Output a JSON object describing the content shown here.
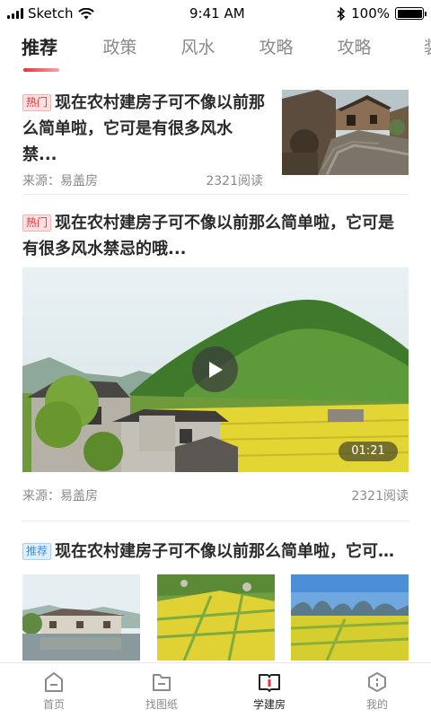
{
  "status_bar": {
    "carrier": "Sketch",
    "time": "9:41 AM",
    "battery": "100%",
    "battery_level": 1.0
  },
  "tabs": [
    {
      "label": "推荐",
      "active": true
    },
    {
      "label": "政策"
    },
    {
      "label": "风水"
    },
    {
      "label": "攻略"
    },
    {
      "label": "攻略"
    },
    {
      "label": "装"
    }
  ],
  "articles": [
    {
      "tag": "热门",
      "title": "现在农村建房子可不像以前那么简单啦，它可是有很多风水禁...",
      "source": "来源：易盖房",
      "reads": "2321阅读"
    },
    {
      "tag": "热门",
      "title": "现在农村建房子可不像以前那么简单啦，它可是有很多风水禁忌的哦...",
      "duration": "01:21",
      "source": "来源：易盖房",
      "reads": "2321阅读"
    },
    {
      "tag": "推荐",
      "title": "现在农村建房子可不像以前那么简单啦，它可是..."
    }
  ],
  "tabbar": [
    {
      "label": "首页",
      "icon": "home-icon"
    },
    {
      "label": "找图纸",
      "icon": "folder-icon"
    },
    {
      "label": "学建房",
      "icon": "book-icon",
      "active": true
    },
    {
      "label": "我的",
      "icon": "profile-icon"
    }
  ],
  "colors": {
    "accent": "#e8333b",
    "tag_hot": "#e8333b",
    "tag_recommend": "#3d8fe0"
  }
}
